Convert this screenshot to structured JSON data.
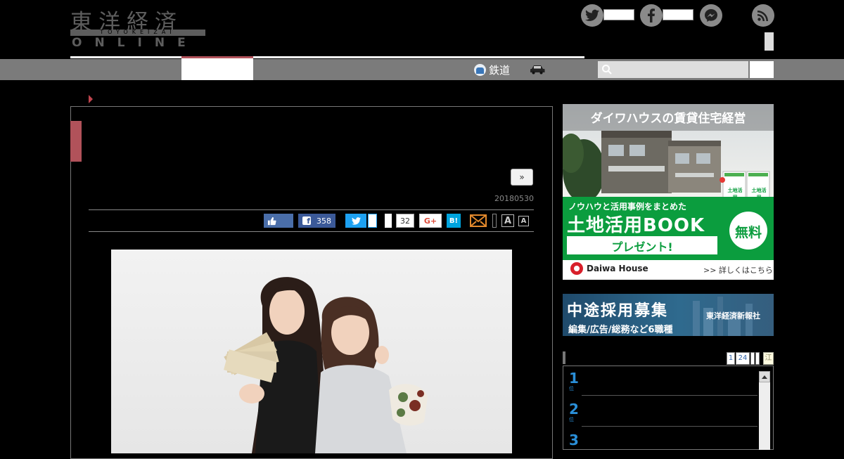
{
  "logo": {
    "kanji": "東洋経済",
    "romaji": "TOYOKEIZAI",
    "online": "ONLINE"
  },
  "nav": {
    "items": [
      {
        "label": "鉄道",
        "icon": "train-icon"
      },
      {
        "label": "",
        "icon": "car-icon"
      }
    ],
    "search_placeholder": ""
  },
  "article": {
    "next_label": "»",
    "date": "20180530",
    "share": {
      "facebook_count": "358",
      "hatena_count": "32",
      "google_label": "G+",
      "hatena_label": "B!",
      "font_large": "A",
      "font_small": "A"
    }
  },
  "ads": {
    "daiwa": {
      "headline": "ダイワハウスの賃貸住宅経営",
      "subline": "ノウハウと活用事例をまとめた",
      "book_title": "土地活用BOOK",
      "free_badge": "無料",
      "present": "プレゼント!",
      "brand": "Daiwa House",
      "more": ">> 詳しくはこちら",
      "book_cover_label": "土地活用"
    },
    "recruit": {
      "headline": "中途採用募集",
      "company": "東洋経済新報社",
      "subline": "編集/広告/総務など6職種"
    }
  },
  "ranking": {
    "tabs": [
      "1",
      "24"
    ],
    "extra_tab": "江",
    "items": [
      {
        "rank": "1",
        "suffix": "位"
      },
      {
        "rank": "2",
        "suffix": "位"
      },
      {
        "rank": "3",
        "suffix": ""
      }
    ]
  },
  "colors": {
    "accent_red": "#b1525a",
    "nav_gray": "#7b7b7b",
    "facebook": "#3b5998",
    "twitter": "#1da1f2",
    "google": "#dd4b39",
    "hatena": "#00a4de"
  }
}
